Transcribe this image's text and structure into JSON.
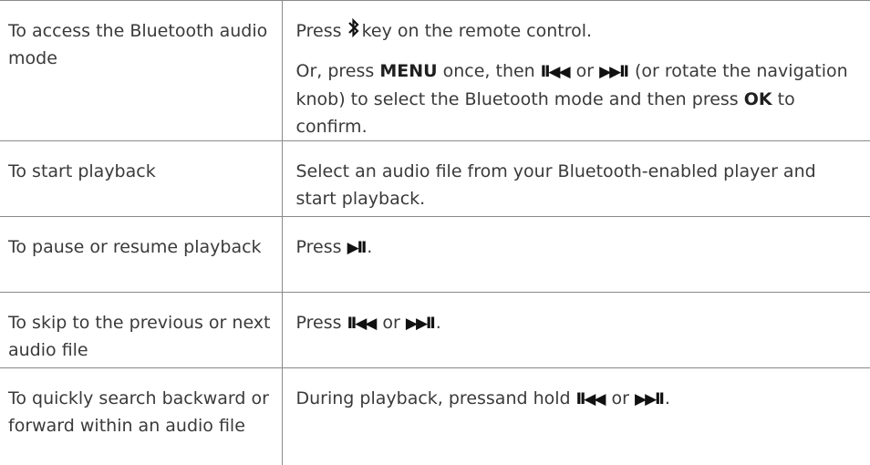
{
  "rows": [
    {
      "action": "To access the Bluetooth audio mode",
      "result_p1_after_icon": "key on the remote control.",
      "result_p1_before_icon": "Press",
      "result_p2": {
        "t1": "Or, press",
        "menu": "MENU",
        "t2": "once, then",
        "prev": "II◀◀",
        "or": "or",
        "next": "▶▶II",
        "t3": "(or rotate the navigation knob) to select the Bluetooth mode and then press",
        "ok": "OK",
        "t4": "to confirm."
      }
    },
    {
      "action": "To start playback",
      "result": "Select an audio file from your Bluetooth-enabled player and start playback."
    },
    {
      "action": "To pause or resume playback",
      "press": "Press",
      "sym": "▶II",
      "end": "."
    },
    {
      "action": "To skip to the previous or next audio file",
      "press": "Press",
      "prev": "II◀◀",
      "or": "or",
      "next": "▶▶II",
      "end": "."
    },
    {
      "action": "To quickly search backward or forward within an audio file",
      "lead": "During playback, pressand hold",
      "prev": "II◀◀",
      "or": "or",
      "next": "▶▶II",
      "end": "."
    }
  ]
}
